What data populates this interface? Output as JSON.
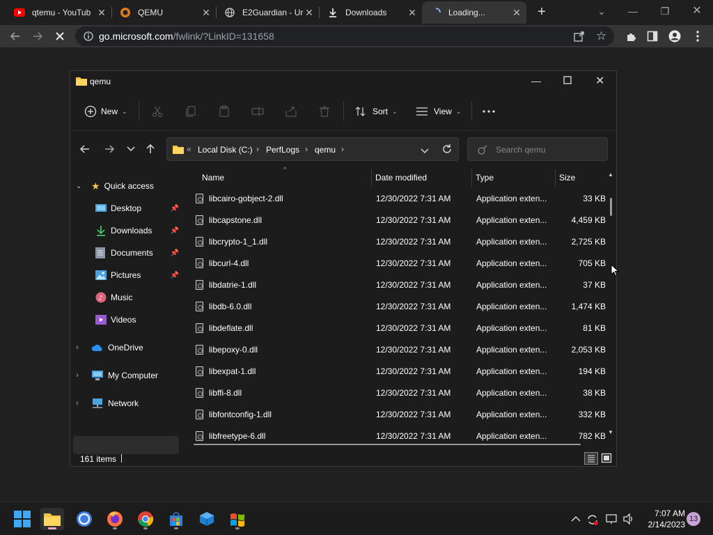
{
  "browser": {
    "tabs": [
      {
        "title": "qtemu - YouTub",
        "icon": "youtube-icon"
      },
      {
        "title": "QEMU",
        "icon": "qemu-icon"
      },
      {
        "title": "E2Guardian - Ur",
        "icon": "globe-icon"
      },
      {
        "title": "Downloads",
        "icon": "download-icon"
      },
      {
        "title": "Loading...",
        "icon": "spinner-icon"
      }
    ],
    "url_host": "go.microsoft.com",
    "url_path": "/fwlink/?LinkID=131658"
  },
  "explorer": {
    "title": "qemu",
    "cmd": {
      "new": "New",
      "sort": "Sort",
      "view": "View"
    },
    "address": {
      "crumbs": [
        "Local Disk (C:)",
        "PerfLogs",
        "qemu"
      ]
    },
    "search_placeholder": "Search qemu",
    "sidebar": {
      "quick_access": "Quick access",
      "items": [
        "Desktop",
        "Downloads",
        "Documents",
        "Pictures",
        "Music",
        "Videos"
      ],
      "onedrive": "OneDrive",
      "mycomputer": "My Computer",
      "network": "Network"
    },
    "columns": {
      "name": "Name",
      "date": "Date modified",
      "type": "Type",
      "size": "Size"
    },
    "files": [
      {
        "name": "libcairo-gobject-2.dll",
        "date": "12/30/2022 7:31 AM",
        "type": "Application exten...",
        "size": "33 KB"
      },
      {
        "name": "libcapstone.dll",
        "date": "12/30/2022 7:31 AM",
        "type": "Application exten...",
        "size": "4,459 KB"
      },
      {
        "name": "libcrypto-1_1.dll",
        "date": "12/30/2022 7:31 AM",
        "type": "Application exten...",
        "size": "2,725 KB"
      },
      {
        "name": "libcurl-4.dll",
        "date": "12/30/2022 7:31 AM",
        "type": "Application exten...",
        "size": "705 KB"
      },
      {
        "name": "libdatrie-1.dll",
        "date": "12/30/2022 7:31 AM",
        "type": "Application exten...",
        "size": "37 KB"
      },
      {
        "name": "libdb-6.0.dll",
        "date": "12/30/2022 7:31 AM",
        "type": "Application exten...",
        "size": "1,474 KB"
      },
      {
        "name": "libdeflate.dll",
        "date": "12/30/2022 7:31 AM",
        "type": "Application exten...",
        "size": "81 KB"
      },
      {
        "name": "libepoxy-0.dll",
        "date": "12/30/2022 7:31 AM",
        "type": "Application exten...",
        "size": "2,053 KB"
      },
      {
        "name": "libexpat-1.dll",
        "date": "12/30/2022 7:31 AM",
        "type": "Application exten...",
        "size": "194 KB"
      },
      {
        "name": "libffi-8.dll",
        "date": "12/30/2022 7:31 AM",
        "type": "Application exten...",
        "size": "38 KB"
      },
      {
        "name": "libfontconfig-1.dll",
        "date": "12/30/2022 7:31 AM",
        "type": "Application exten...",
        "size": "332 KB"
      },
      {
        "name": "libfreetype-6.dll",
        "date": "12/30/2022 7:31 AM",
        "type": "Application exten...",
        "size": "782 KB"
      }
    ],
    "status": "161 items"
  },
  "taskbar": {
    "time": "7:07 AM",
    "date": "2/14/2023",
    "notif_count": "13"
  },
  "colors": {
    "accent": "#0078d4",
    "folder": "#f4c542",
    "star": "#f7c948"
  }
}
